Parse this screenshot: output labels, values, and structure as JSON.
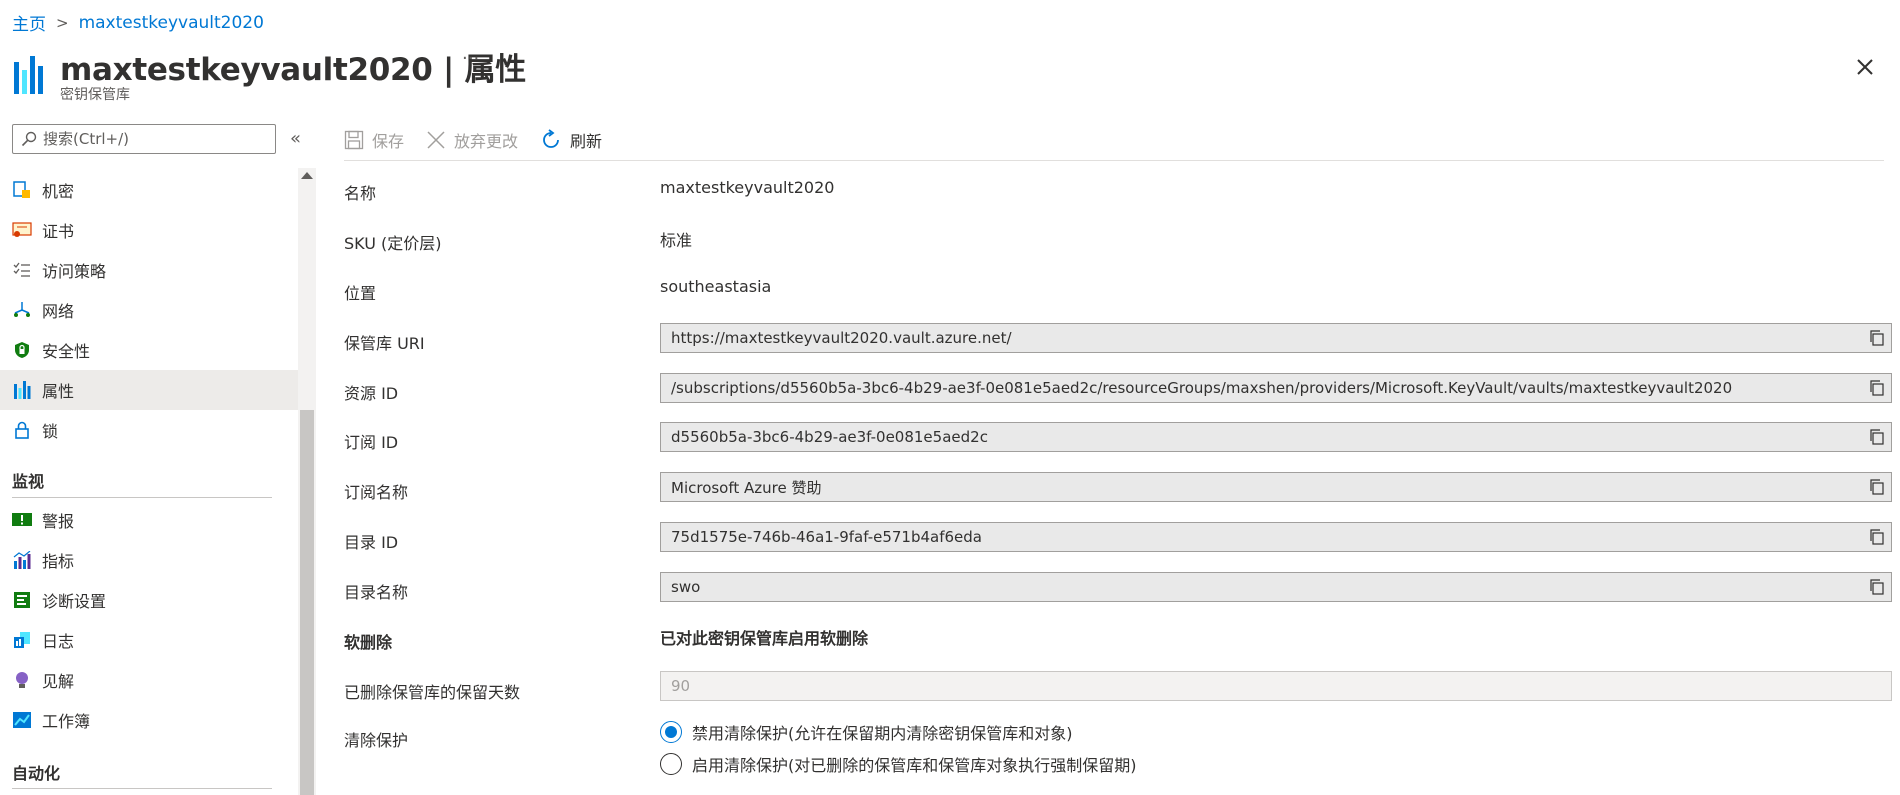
{
  "breadcrumb": {
    "home": "主页",
    "current": "maxtestkeyvault2020"
  },
  "header": {
    "title": "maxtestkeyvault2020 | 属性",
    "subtitle": "密钥保管库",
    "more": "···"
  },
  "search": {
    "placeholder": "搜索(Ctrl+/)",
    "value": ""
  },
  "sidebar": {
    "collapse": "«",
    "items": [
      {
        "label": "机密",
        "icon": "key-secret-icon"
      },
      {
        "label": "证书",
        "icon": "certificate-icon"
      },
      {
        "label": "访问策略",
        "icon": "access-policy-icon"
      },
      {
        "label": "网络",
        "icon": "network-icon"
      },
      {
        "label": "安全性",
        "icon": "security-shield-icon"
      },
      {
        "label": "属性",
        "icon": "properties-icon"
      },
      {
        "label": "锁",
        "icon": "lock-icon"
      }
    ],
    "sections": [
      {
        "title": "监视",
        "items": [
          {
            "label": "警报",
            "icon": "alert-icon"
          },
          {
            "label": "指标",
            "icon": "metrics-icon"
          },
          {
            "label": "诊断设置",
            "icon": "diagnostics-icon"
          },
          {
            "label": "日志",
            "icon": "logs-icon"
          },
          {
            "label": "见解",
            "icon": "insights-icon"
          },
          {
            "label": "工作簿",
            "icon": "workbook-icon"
          }
        ]
      },
      {
        "title": "自动化",
        "items": []
      }
    ]
  },
  "toolbar": {
    "save": "保存",
    "discard": "放弃更改",
    "refresh": "刷新"
  },
  "properties": {
    "name": {
      "label": "名称",
      "value": "maxtestkeyvault2020"
    },
    "sku": {
      "label": "SKU (定价层)",
      "value": "标准"
    },
    "location": {
      "label": "位置",
      "value": "southeastasia"
    },
    "vault_uri": {
      "label": "保管库 URI",
      "value": "https://maxtestkeyvault2020.vault.azure.net/"
    },
    "resource_id": {
      "label": "资源 ID",
      "value": "/subscriptions/d5560b5a-3bc6-4b29-ae3f-0e081e5aed2c/resourceGroups/maxshen/providers/Microsoft.KeyVault/vaults/maxtestkeyvault2020"
    },
    "subscription_id": {
      "label": "订阅 ID",
      "value": "d5560b5a-3bc6-4b29-ae3f-0e081e5aed2c"
    },
    "subscription_name": {
      "label": "订阅名称",
      "value": "Microsoft Azure 赞助"
    },
    "directory_id": {
      "label": "目录 ID",
      "value": "75d1575e-746b-46a1-9faf-e571b4af6eda"
    },
    "directory_name": {
      "label": "目录名称",
      "value": "swo"
    },
    "soft_delete": {
      "label": "软删除",
      "value": "已对此密钥保管库启用软删除"
    },
    "retention_days": {
      "label": "已删除保管库的保留天数",
      "value": "90"
    },
    "purge_protection": {
      "label": "清除保护",
      "options": [
        {
          "label": "禁用清除保护(允许在保留期内清除密钥保管库和对象)",
          "checked": true
        },
        {
          "label": "启用清除保护(对已删除的保管库和保管库对象执行强制保留期)",
          "checked": false
        }
      ]
    }
  },
  "colors": {
    "accent": "#0078d4",
    "text": "#323130",
    "muted": "#a19f9d",
    "field_bg": "#e9e9e9"
  }
}
